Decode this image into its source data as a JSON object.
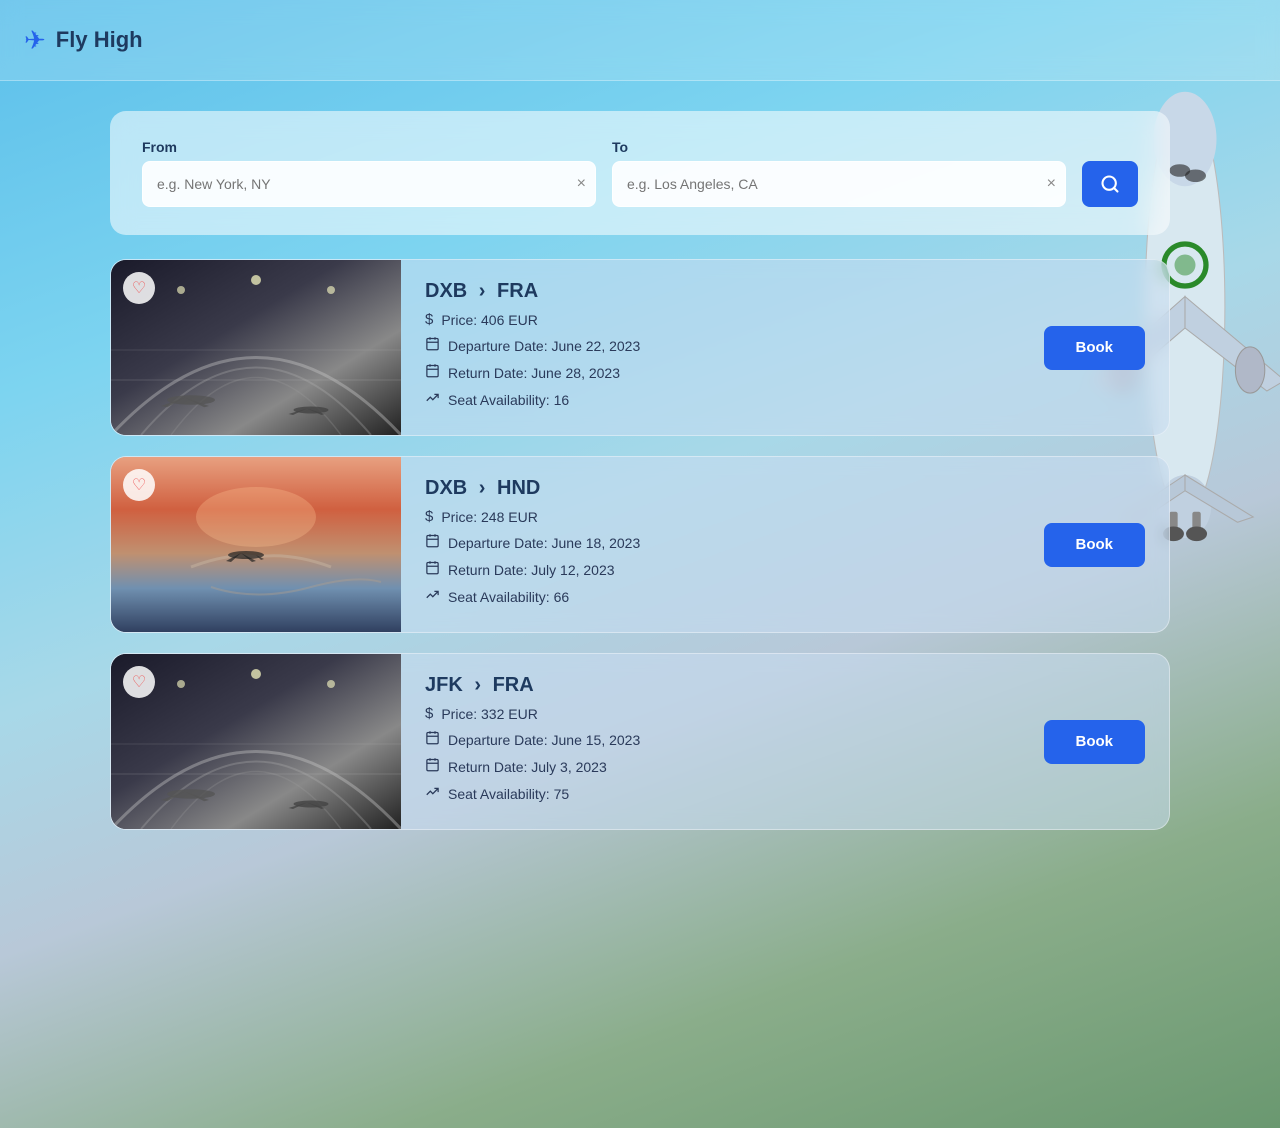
{
  "brand": {
    "name": "Fly High",
    "icon": "✈"
  },
  "search": {
    "from_label": "From",
    "to_label": "To",
    "from_placeholder": "e.g. New York, NY",
    "to_placeholder": "e.g. Los Angeles, CA",
    "from_value": "",
    "to_value": "",
    "button_icon": "🔍"
  },
  "flights": [
    {
      "origin": "DXB",
      "destination": "FRA",
      "arrow": ">",
      "price": "Price: 406 EUR",
      "departure": "Departure Date: June 22, 2023",
      "return": "Return Date: June 28, 2023",
      "seats": "Seat Availability: 16",
      "book_label": "Book",
      "img_class": "img-airport"
    },
    {
      "origin": "DXB",
      "destination": "HND",
      "arrow": ">",
      "price": "Price: 248 EUR",
      "departure": "Departure Date: June 18, 2023",
      "return": "Return Date: July 12, 2023",
      "seats": "Seat Availability: 66",
      "book_label": "Book",
      "img_class": "img-sky"
    },
    {
      "origin": "JFK",
      "destination": "FRA",
      "arrow": ">",
      "price": "Price: 332 EUR",
      "departure": "Departure Date: June 15, 2023",
      "return": "Return Date: July 3, 2023",
      "seats": "Seat Availability: 75",
      "book_label": "Book",
      "img_class": "img-airport2"
    }
  ]
}
